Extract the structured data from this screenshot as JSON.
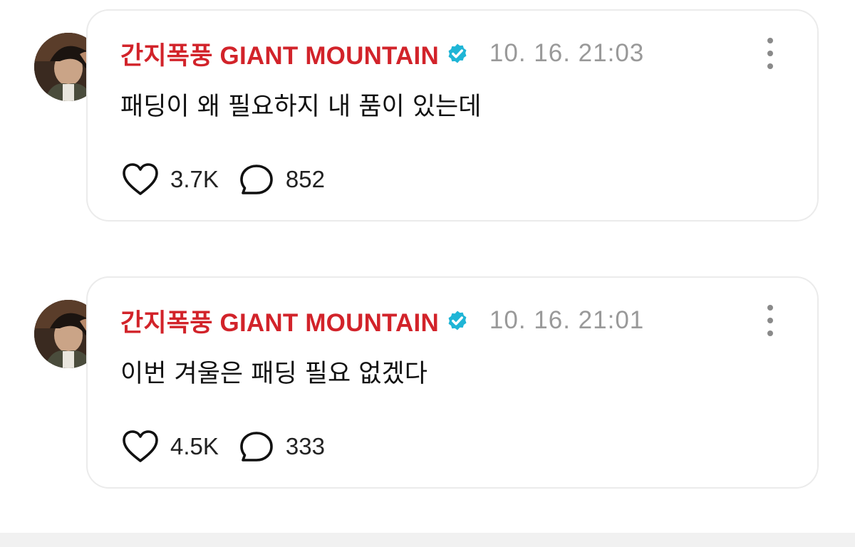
{
  "posts": [
    {
      "author": "간지폭풍 GIANT MOUNTAIN",
      "timestamp": "10. 16. 21:03",
      "text": "패딩이 왜 필요하지 내 품이 있는데",
      "likes": "3.7K",
      "comments": "852"
    },
    {
      "author": "간지폭풍 GIANT MOUNTAIN",
      "timestamp": "10. 16. 21:01",
      "text": "이번 겨울은 패딩 필요 없겠다",
      "likes": "4.5K",
      "comments": "333"
    }
  ],
  "icons": {
    "verified": "verified-badge-icon",
    "like": "heart-icon",
    "comment": "speech-bubble-icon",
    "more": "more-vertical-icon"
  },
  "colors": {
    "author": "#d2232a",
    "verified": "#1fb5d6",
    "timestamp": "#999999",
    "card_border": "#ebebeb"
  }
}
